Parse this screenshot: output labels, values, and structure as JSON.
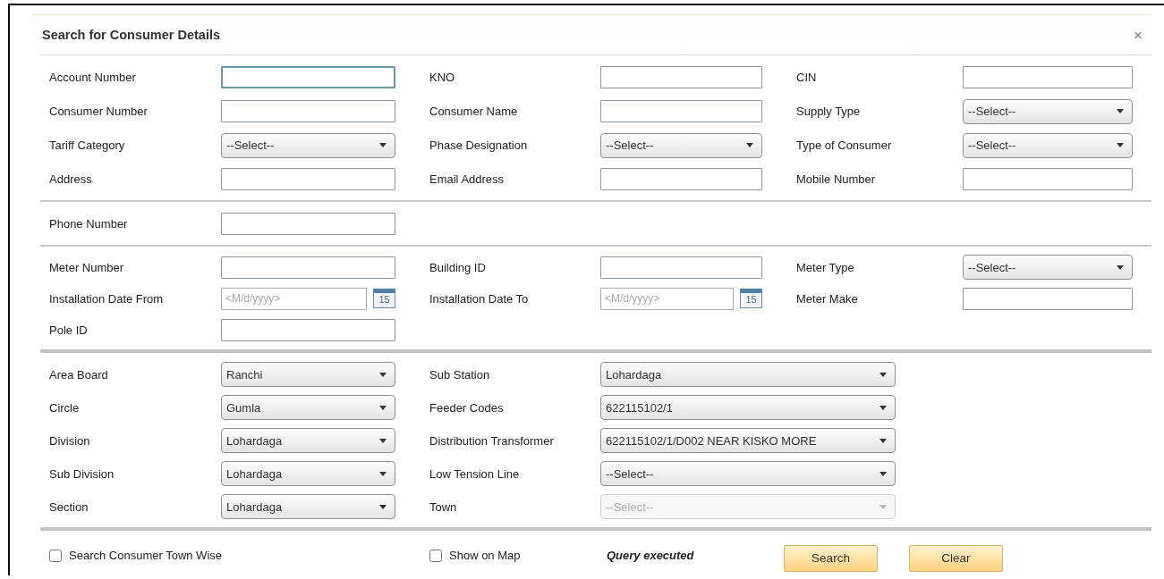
{
  "dialog": {
    "title": "Search for Consumer Details",
    "close": "×"
  },
  "sections": [
    {
      "rows": [
        [
          {
            "label": "Account Number",
            "kind": "text",
            "focused": true
          },
          {
            "label": "KNO",
            "kind": "text",
            "focused": false
          },
          {
            "label": "CIN",
            "kind": "text",
            "focused": false
          }
        ],
        [
          {
            "label": "Consumer Number",
            "kind": "text",
            "focused": false
          },
          {
            "label": "Consumer Name",
            "kind": "text",
            "focused": false
          },
          {
            "label": "Supply Type",
            "kind": "select",
            "value": "--Select--",
            "disabled": false
          }
        ],
        [
          {
            "label": "Tariff Category",
            "kind": "select",
            "value": "--Select--",
            "disabled": false
          },
          {
            "label": "Phase Designation",
            "kind": "select",
            "value": "--Select--",
            "disabled": false
          },
          {
            "label": "Type of Consumer",
            "kind": "select",
            "value": "--Select--",
            "disabled": false
          }
        ],
        [
          {
            "label": "Address",
            "kind": "text",
            "focused": false
          },
          {
            "label": "Email Address",
            "kind": "text",
            "focused": false
          },
          {
            "label": "Mobile Number",
            "kind": "text",
            "focused": false
          }
        ]
      ]
    },
    {
      "rows": [
        [
          {
            "label": "Phone Number",
            "kind": "text",
            "focused": false
          }
        ]
      ]
    },
    {
      "rows": [
        [
          {
            "label": "Meter Number",
            "kind": "text",
            "focused": false
          },
          {
            "label": "Building ID",
            "kind": "text",
            "focused": false
          },
          {
            "label": "Meter Type",
            "kind": "select",
            "value": "--Select--",
            "disabled": false
          }
        ],
        [
          {
            "label": "Installation Date From",
            "kind": "date",
            "placeholder": "<M/d/yyyy>",
            "icon_text": "15"
          },
          {
            "label": "Installation Date To",
            "kind": "date",
            "placeholder": "<M/d/yyyy>",
            "icon_text": "15"
          },
          {
            "label": "Meter Make",
            "kind": "text",
            "focused": false
          }
        ],
        [
          {
            "label": "Pole ID",
            "kind": "text",
            "focused": false
          }
        ]
      ]
    },
    {
      "rows": [
        [
          {
            "label": "Area Board",
            "kind": "select",
            "value": "Ranchi",
            "disabled": false
          },
          {
            "label": "Sub Station",
            "kind": "select",
            "value": "Lohardaga",
            "disabled": false
          }
        ],
        [
          {
            "label": "Circle",
            "kind": "select",
            "value": "Gumla",
            "disabled": false
          },
          {
            "label": "Feeder Codes",
            "kind": "select",
            "value": "622115102/1",
            "disabled": false
          }
        ],
        [
          {
            "label": "Division",
            "kind": "select",
            "value": "Lohardaga",
            "disabled": false
          },
          {
            "label": "Distribution Transformer",
            "kind": "select",
            "value": "622115102/1/D002 NEAR KISKO MORE",
            "disabled": false
          }
        ],
        [
          {
            "label": "Sub Division",
            "kind": "select",
            "value": "Lohardaga",
            "disabled": false
          },
          {
            "label": "Low Tension Line",
            "kind": "select",
            "value": "--Select--",
            "disabled": false
          }
        ],
        [
          {
            "label": "Section",
            "kind": "select",
            "value": "Lohardaga",
            "disabled": false
          },
          {
            "label": "Town",
            "kind": "select",
            "value": "--Select--",
            "disabled": true
          }
        ]
      ]
    }
  ],
  "footer": {
    "checkboxes": [
      {
        "label": "Search Consumer Town Wise",
        "checked": false
      },
      {
        "label": "Show on Map",
        "checked": false
      }
    ],
    "status": "Query executed",
    "buttons": [
      "Search",
      "Clear"
    ]
  }
}
